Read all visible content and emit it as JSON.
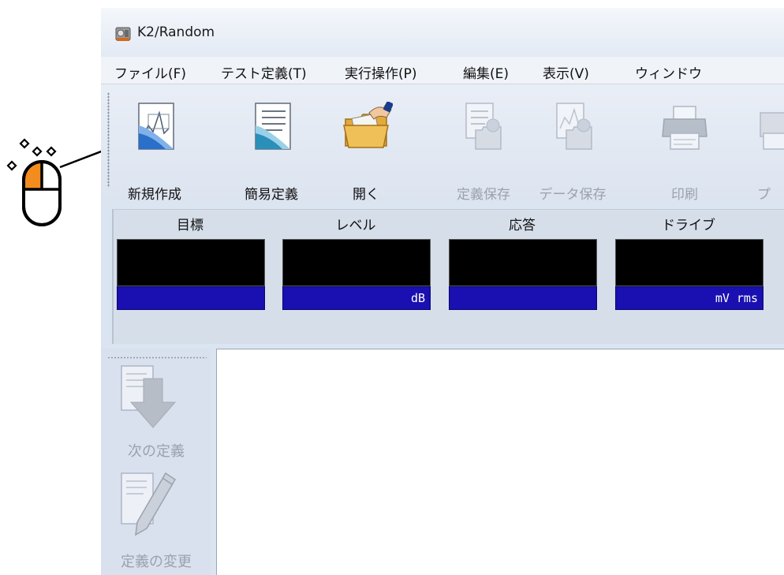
{
  "window": {
    "title": "K2/Random",
    "logo_icon": "k2-logo-icon"
  },
  "menubar": {
    "items": [
      {
        "label": "ファイル(F)"
      },
      {
        "label": "テスト定義(T)"
      },
      {
        "label": "実行操作(P)"
      },
      {
        "label": "編集(E)"
      },
      {
        "label": "表示(V)"
      },
      {
        "label": "ウィンドウ"
      }
    ]
  },
  "toolbar": {
    "buttons": [
      {
        "label": "新規作成",
        "icon": "new-document-icon",
        "enabled": true
      },
      {
        "label": "簡易定義",
        "icon": "simple-definition-icon",
        "enabled": true
      },
      {
        "label": "開く",
        "icon": "open-folder-icon",
        "enabled": true
      },
      {
        "label": "定義保存",
        "icon": "save-definition-icon",
        "enabled": false
      },
      {
        "label": "データ保存",
        "icon": "save-data-icon",
        "enabled": false
      },
      {
        "label": "印刷",
        "icon": "printer-icon",
        "enabled": false
      },
      {
        "label": "プ",
        "icon": "preview-icon",
        "enabled": false
      }
    ]
  },
  "meters": [
    {
      "label": "目標",
      "unit": ""
    },
    {
      "label": "レベル",
      "unit": "dB"
    },
    {
      "label": "応答",
      "unit": ""
    },
    {
      "label": "ドライブ",
      "unit": "mV rms"
    }
  ],
  "side_toolbar": {
    "buttons": [
      {
        "label": "次の定義",
        "icon": "next-definition-icon",
        "enabled": false
      },
      {
        "label": "定義の変更",
        "icon": "edit-definition-icon",
        "enabled": false
      }
    ]
  },
  "annotation": {
    "icon": "mouse-left-click-icon",
    "target": "new-document-button"
  },
  "colors": {
    "app_background": "#dbe4f1",
    "meter_display": "#000000",
    "meter_unit_bar": "#1a0fb0",
    "mouse_accent": "#f28c1e"
  }
}
